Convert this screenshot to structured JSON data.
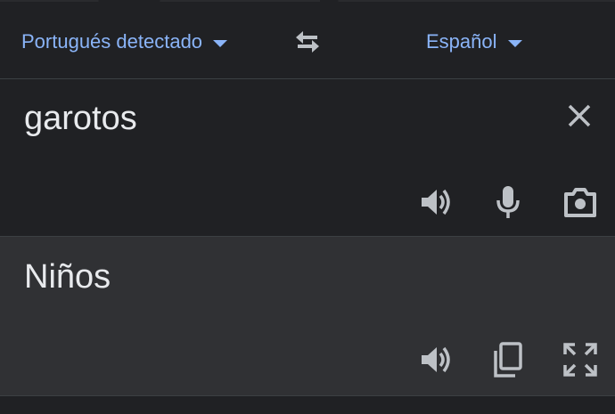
{
  "header": {
    "source_language": "Portugués detectado",
    "target_language": "Español"
  },
  "source": {
    "text": "garotos",
    "icons": [
      "close-icon",
      "speaker-icon",
      "microphone-icon",
      "camera-icon"
    ]
  },
  "translation": {
    "text": "Niños",
    "icons": [
      "speaker-icon",
      "copy-icon",
      "fullscreen-icon"
    ]
  },
  "colors": {
    "background": "#202124",
    "translation_background": "#303134",
    "accent": "#8ab4f8",
    "text": "#e8eaed",
    "icon": "#bdc1c6"
  }
}
